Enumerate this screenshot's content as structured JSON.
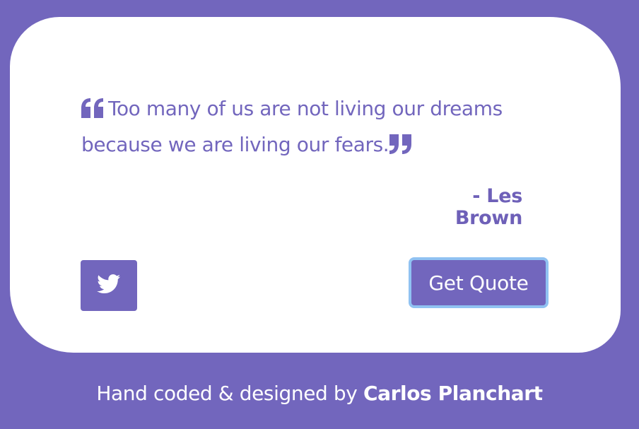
{
  "quote": {
    "text": "Too many of us are not living our dreams because we are living our fears.",
    "open_icon": "quote-left-icon",
    "close_icon": "quote-right-icon"
  },
  "author": {
    "label": "- Les Brown"
  },
  "actions": {
    "tweet_icon": "twitter-icon",
    "get_quote_label": "Get Quote"
  },
  "footer": {
    "prefix": "Hand coded & designed by ",
    "author_name": "Carlos Planchart"
  },
  "colors": {
    "background": "#7266bd",
    "card": "#ffffff",
    "accent": "#7266bd",
    "focus_ring": "#90c2f2"
  }
}
